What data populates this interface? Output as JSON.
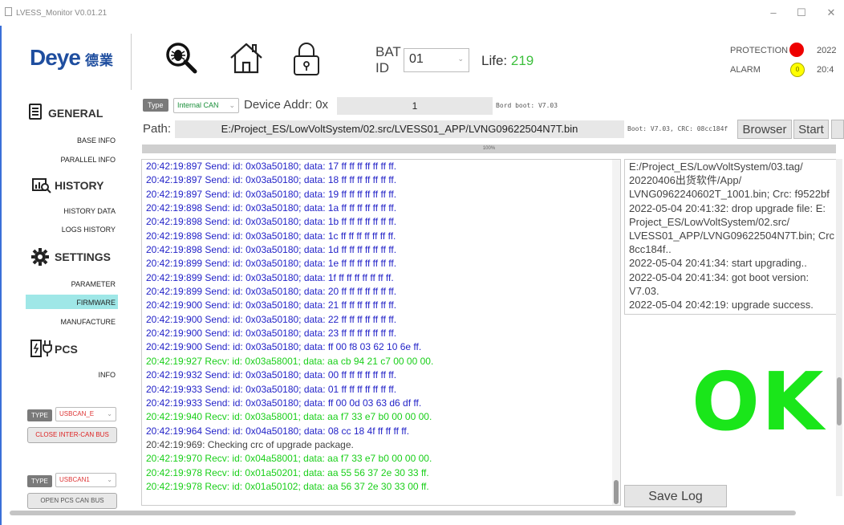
{
  "window": {
    "title": "LVESS_Monitor V0.01.21",
    "controls": {
      "minimize": "–",
      "maximize": "☐",
      "close": "✕"
    }
  },
  "header": {
    "logo": "Deye",
    "logo_cn": "德業",
    "bat_label_1": "BAT",
    "bat_label_2": "ID",
    "bat_id": "01",
    "life_label": "Life:",
    "life_value": "219",
    "protection_label": "PROTECTION",
    "alarm_label": "ALARM",
    "alarm_value": "0",
    "date_1": "2022",
    "date_2": "20:4",
    "icons": [
      "search-bug-icon",
      "home-icon",
      "lock-icon"
    ]
  },
  "sidebar": {
    "general": "GENERAL",
    "general_items": [
      "BASE INFO",
      "PARALLEL INFO"
    ],
    "history": "HISTORY",
    "history_items": [
      "HISTORY DATA",
      "LOGS HISTORY"
    ],
    "settings": "SETTINGS",
    "settings_items": [
      "PARAMETER",
      "FIRMWARE",
      "MANUFACTURE"
    ],
    "pcs": "PCS",
    "pcs_items": [
      "INFO"
    ],
    "selected": "FIRMWARE",
    "bus1": {
      "type_label": "TYPE",
      "type_value": "USBCAN_E",
      "button": "CLOSE INTER-CAN BUS"
    },
    "bus2": {
      "type_label": "TYPE",
      "type_value": "USBCAN1",
      "button": "OPEN PCS CAN BUS"
    }
  },
  "main": {
    "type_label": "Type",
    "type_value": "Internal CAN",
    "device_addr_label": "Device Addr: 0x",
    "device_addr_value": "1",
    "bord_boot": "Bord boot: V7.03",
    "path_label": "Path:",
    "path_value": "E:/Project_ES/LowVoltSystem/02.src/LVESS01_APP/LVNG09622504N7T.bin",
    "boot_crc": "Boot: V7.03, CRC: 08cc184f",
    "browser_button": "Browser",
    "start_button": "Start",
    "progress_value": 100,
    "progress_text": "100%",
    "ok_text": "OK",
    "save_log_button": "Save Log"
  },
  "colors": {
    "send": "#2323c8",
    "recv": "#19cf19",
    "info": "#444444",
    "ok": "#1ae61a",
    "accent": "#1f4e9f"
  },
  "log": [
    {
      "kind": "send",
      "text": "20:42:19:897 Send: id: 0x03a50180; data: 17 ff ff ff ff ff ff ff."
    },
    {
      "kind": "send",
      "text": "20:42:19:897 Send: id: 0x03a50180; data: 18 ff ff ff ff ff ff ff."
    },
    {
      "kind": "send",
      "text": "20:42:19:897 Send: id: 0x03a50180; data: 19 ff ff ff ff ff ff ff."
    },
    {
      "kind": "send",
      "text": "20:42:19:898 Send: id: 0x03a50180; data: 1a ff ff ff ff ff ff ff."
    },
    {
      "kind": "send",
      "text": "20:42:19:898 Send: id: 0x03a50180; data: 1b ff ff ff ff ff ff ff."
    },
    {
      "kind": "send",
      "text": "20:42:19:898 Send: id: 0x03a50180; data: 1c ff ff ff ff ff ff ff."
    },
    {
      "kind": "send",
      "text": "20:42:19:898 Send: id: 0x03a50180; data: 1d ff ff ff ff ff ff ff."
    },
    {
      "kind": "send",
      "text": "20:42:19:899 Send: id: 0x03a50180; data: 1e ff ff ff ff ff ff ff."
    },
    {
      "kind": "send",
      "text": "20:42:19:899 Send: id: 0x03a50180; data: 1f ff ff ff ff ff ff ff."
    },
    {
      "kind": "send",
      "text": "20:42:19:899 Send: id: 0x03a50180; data: 20 ff ff ff ff ff ff ff."
    },
    {
      "kind": "send",
      "text": "20:42:19:900 Send: id: 0x03a50180; data: 21 ff ff ff ff ff ff ff."
    },
    {
      "kind": "send",
      "text": "20:42:19:900 Send: id: 0x03a50180; data: 22 ff ff ff ff ff ff ff."
    },
    {
      "kind": "send",
      "text": "20:42:19:900 Send: id: 0x03a50180; data: 23 ff ff ff ff ff ff ff."
    },
    {
      "kind": "send",
      "text": "20:42:19:900 Send: id: 0x03a50180; data: ff 00 f8 03 62 10 6e ff."
    },
    {
      "kind": "recv",
      "text": "20:42:19:927 Recv: id: 0x03a58001; data: aa cb 94 21 c7 00 00 00."
    },
    {
      "kind": "send",
      "text": "20:42:19:932 Send: id: 0x03a50180; data: 00 ff ff ff ff ff ff ff."
    },
    {
      "kind": "send",
      "text": "20:42:19:933 Send: id: 0x03a50180; data: 01 ff ff ff ff ff ff ff."
    },
    {
      "kind": "send",
      "text": "20:42:19:933 Send: id: 0x03a50180; data: ff 00 0d 03 63 d6 df ff."
    },
    {
      "kind": "recv",
      "text": "20:42:19:940 Recv: id: 0x03a58001; data: aa f7 33 e7 b0 00 00 00."
    },
    {
      "kind": "send",
      "text": "20:42:19:964 Send: id: 0x04a50180; data: 08 cc 18 4f ff ff ff ff."
    },
    {
      "kind": "info",
      "text": "20:42:19:969: Checking crc of upgrade package."
    },
    {
      "kind": "recv",
      "text": "20:42:19:970 Recv: id: 0x04a58001; data: aa f7 33 e7 b0 00 00 00."
    },
    {
      "kind": "recv",
      "text": "20:42:19:978 Recv: id: 0x01a50201; data: aa 55 56 37 2e 30 33 ff."
    },
    {
      "kind": "recv",
      "text": "20:42:19:978 Recv: id: 0x01a50102; data: aa 56 37 2e 30 33 00 ff."
    }
  ],
  "info_log": [
    "E:/Project_ES/LowVoltSystem/03.tag/",
    "20220406出货软件/App/",
    "LVNG0962240602T_1001.bin; Crc: f9522bf",
    "2022-05-04 20:41:32: drop upgrade file: E:",
    "Project_ES/LowVoltSystem/02.src/",
    "LVESS01_APP/LVNG09622504N7T.bin; Crc",
    "8cc184f..",
    "2022-05-04 20:41:34: start upgrading..",
    "2022-05-04 20:41:34: got boot version:",
    "V7.03.",
    "2022-05-04 20:42:19: upgrade success."
  ]
}
